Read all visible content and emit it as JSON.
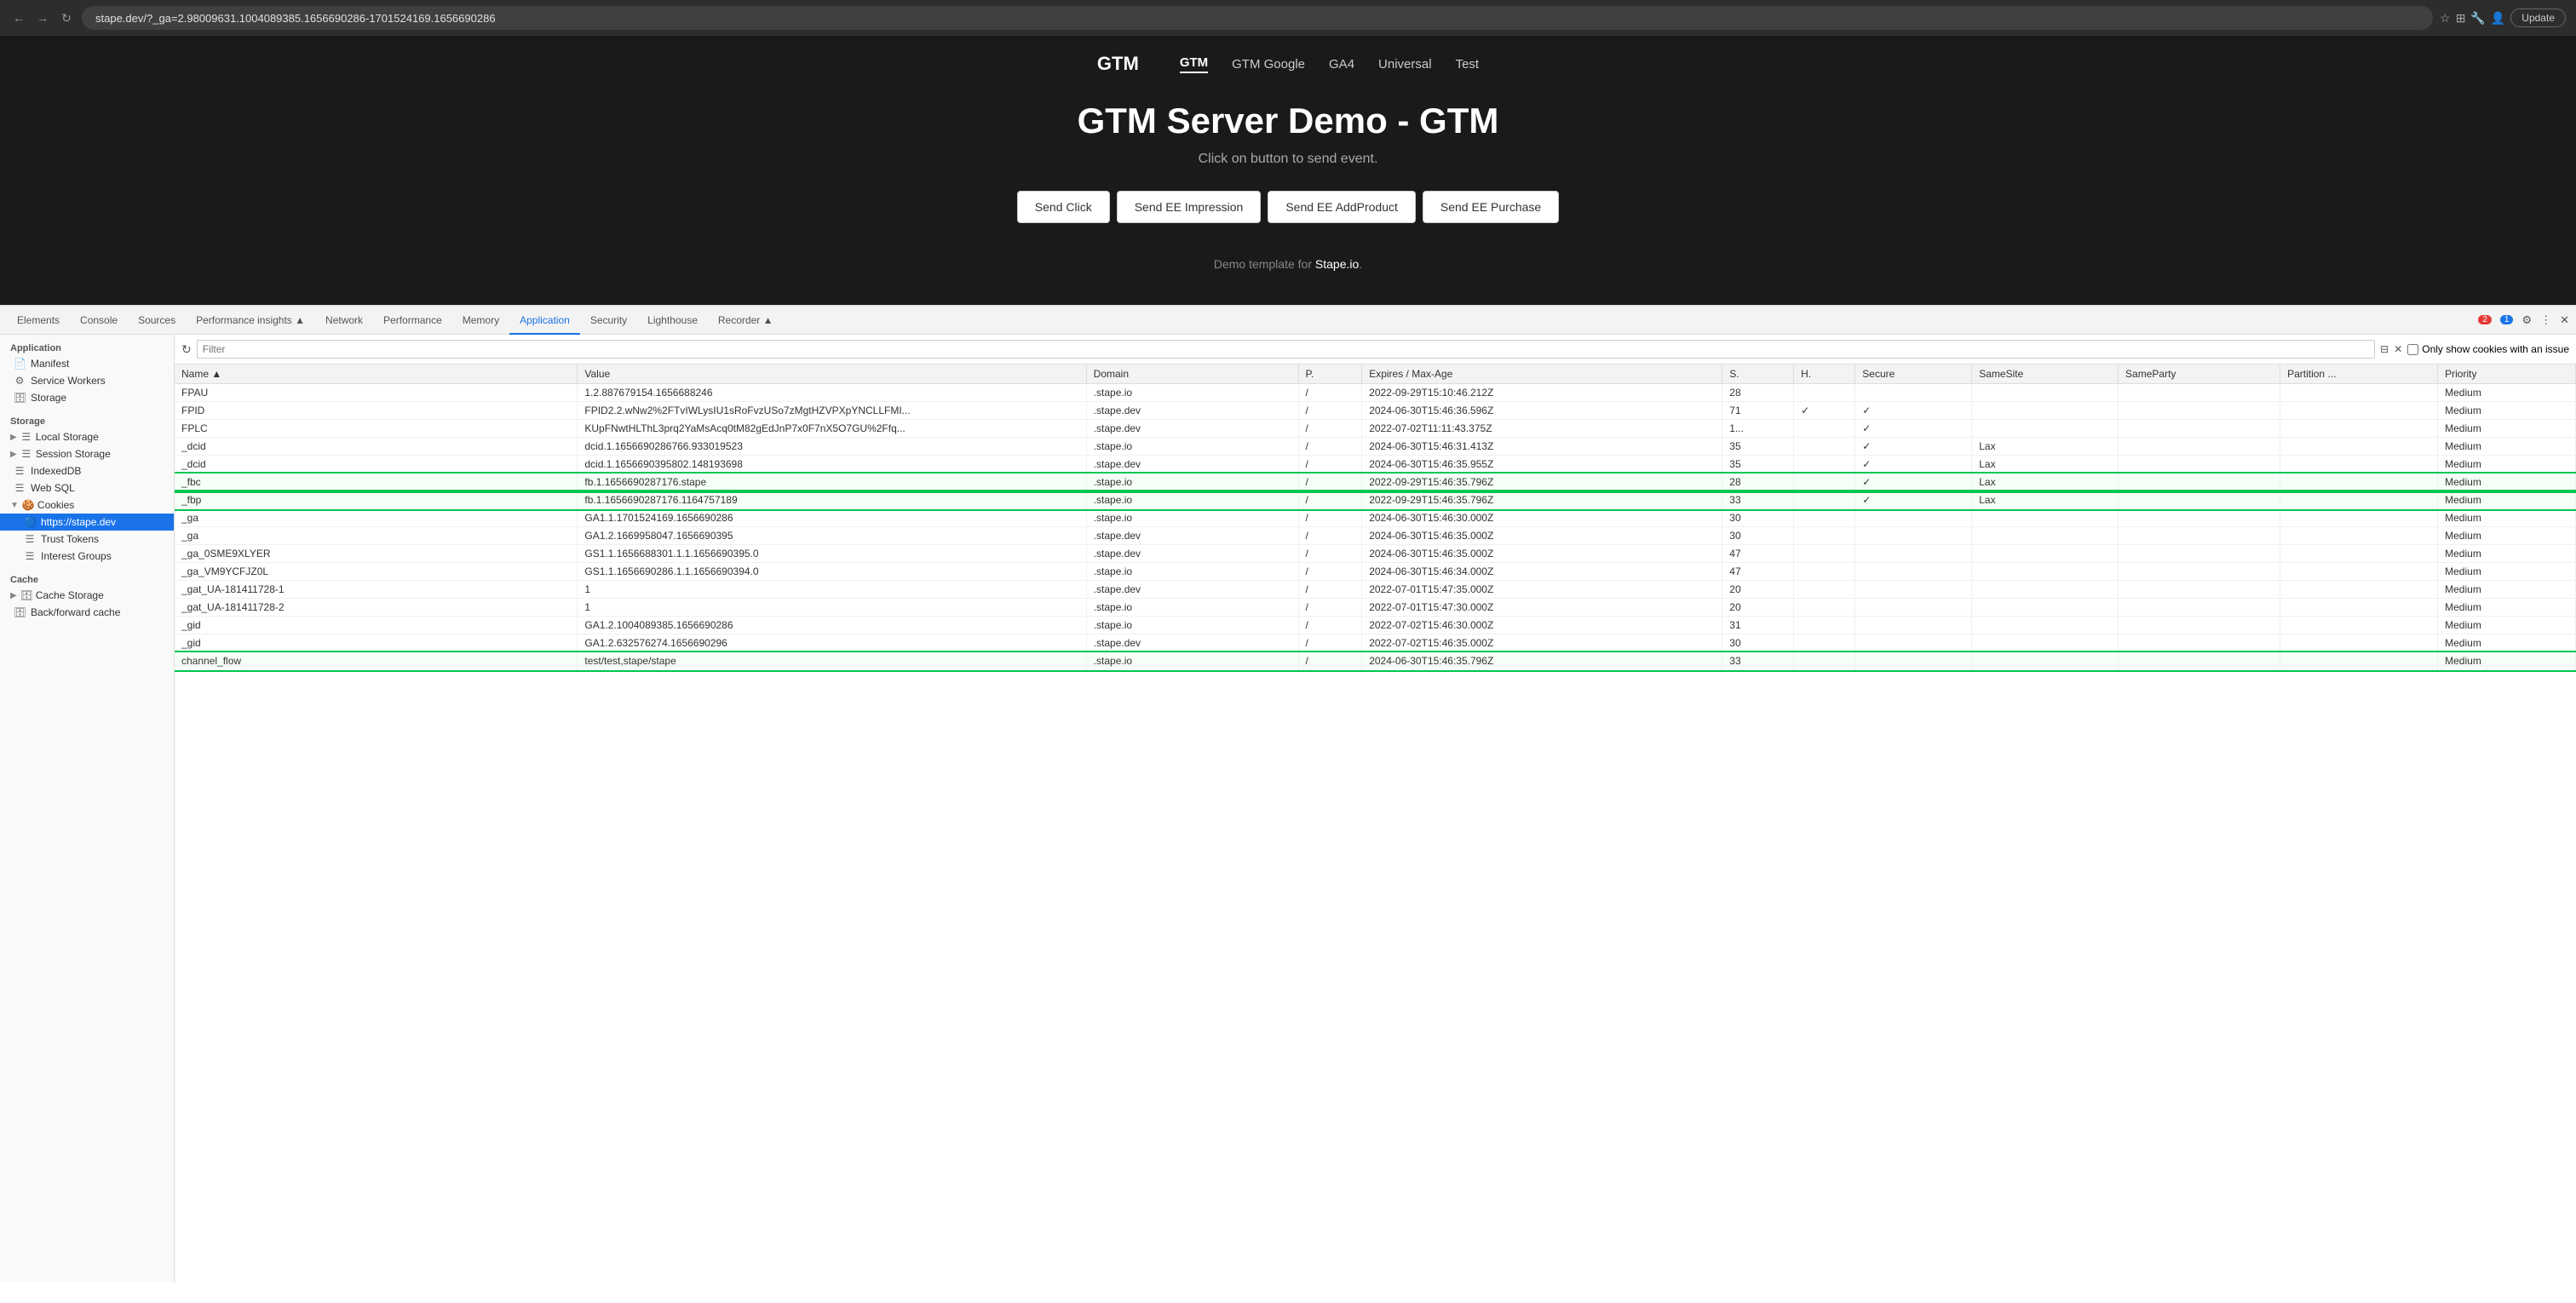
{
  "browser": {
    "url": "stape.dev/?_ga=2.98009631.1004089385.1656690286-1701524169.1656690286",
    "update_label": "Update"
  },
  "site": {
    "logo": "GTM",
    "nav_items": [
      {
        "label": "GTM",
        "active": true
      },
      {
        "label": "GTM Google",
        "active": false
      },
      {
        "label": "GA4",
        "active": false
      },
      {
        "label": "Universal",
        "active": false
      },
      {
        "label": "Test",
        "active": false
      }
    ],
    "title": "GTM Server Demo - GTM",
    "subtitle": "Click on button to send event.",
    "buttons": [
      {
        "label": "Send Click"
      },
      {
        "label": "Send EE Impression"
      },
      {
        "label": "Send EE AddProduct"
      },
      {
        "label": "Send EE Purchase"
      }
    ],
    "footer": "Demo template for Stape.io."
  },
  "devtools": {
    "tabs": [
      {
        "label": "Elements"
      },
      {
        "label": "Console"
      },
      {
        "label": "Sources"
      },
      {
        "label": "Performance insights"
      },
      {
        "label": "Network"
      },
      {
        "label": "Performance"
      },
      {
        "label": "Memory"
      },
      {
        "label": "Application",
        "active": true
      },
      {
        "label": "Security"
      },
      {
        "label": "Lighthouse"
      },
      {
        "label": "Recorder"
      }
    ],
    "badge_red": "2",
    "badge_blue": "1",
    "sidebar": {
      "sections": [
        {
          "title": "Application",
          "items": [
            {
              "label": "Manifest",
              "icon": "📄",
              "type": "item"
            },
            {
              "label": "Service Workers",
              "icon": "⚙",
              "type": "item"
            },
            {
              "label": "Storage",
              "icon": "🗄",
              "type": "item"
            }
          ]
        },
        {
          "title": "Storage",
          "items": [
            {
              "label": "Local Storage",
              "icon": "☰",
              "type": "group",
              "expanded": false
            },
            {
              "label": "Session Storage",
              "icon": "☰",
              "type": "group",
              "expanded": false
            },
            {
              "label": "IndexedDB",
              "icon": "☰",
              "type": "item"
            },
            {
              "label": "Web SQL",
              "icon": "☰",
              "type": "item"
            },
            {
              "label": "Cookies",
              "icon": "🍪",
              "type": "group",
              "expanded": true
            }
          ]
        },
        {
          "title": "Cookies",
          "items": [
            {
              "label": "https://stape.dev",
              "icon": "🔵",
              "type": "item",
              "active": true
            },
            {
              "label": "Trust Tokens",
              "icon": "☰",
              "type": "item"
            },
            {
              "label": "Interest Groups",
              "icon": "☰",
              "type": "item"
            }
          ]
        },
        {
          "title": "Cache",
          "items": [
            {
              "label": "Cache Storage",
              "icon": "🗄",
              "type": "group",
              "expanded": false
            },
            {
              "label": "Back/forward cache",
              "icon": "🗄",
              "type": "item"
            }
          ]
        }
      ]
    },
    "filter": {
      "placeholder": "Filter",
      "show_cookies_with_issue": "Only show cookies with an issue"
    },
    "table": {
      "columns": [
        "Name",
        "Value",
        "Domain",
        "P.",
        "Expires / Max-Age",
        "S.",
        "H.",
        "Secure",
        "SameSite",
        "SameParty",
        "Partition ...",
        "Priority"
      ],
      "rows": [
        {
          "name": "FPAU",
          "value": "1.2.887679154.1656688246",
          "domain": ".stape.io",
          "path": "/",
          "expires": "2022-09-29T15:10:46.212Z",
          "size": "28",
          "h": "",
          "secure": "",
          "samesite": "",
          "sameparty": "",
          "partition": "",
          "priority": "Medium",
          "highlighted": false
        },
        {
          "name": "FPID",
          "value": "FPID2.2.wNw2%2FTvIWLysIU1sRoFvzUSo7zMgtHZVPXpYNCLLFMI...",
          "domain": ".stape.dev",
          "path": "/",
          "expires": "2024-06-30T15:46:36.596Z",
          "size": "71",
          "h": "✓",
          "secure": "✓",
          "samesite": "",
          "sameparty": "",
          "partition": "",
          "priority": "Medium",
          "highlighted": false
        },
        {
          "name": "FPLC",
          "value": "KUpFNwtHLThL3prq2YaMsAcq0tM82gEdJnP7x0F7nX5O7GU%2Ffq...",
          "domain": ".stape.dev",
          "path": "/",
          "expires": "2022-07-02T11:11:43.375Z",
          "size": "1...",
          "h": "",
          "secure": "✓",
          "samesite": "",
          "sameparty": "",
          "partition": "",
          "priority": "Medium",
          "highlighted": false
        },
        {
          "name": "_dcid",
          "value": "dcid.1.1656690286766.933019523",
          "domain": ".stape.io",
          "path": "/",
          "expires": "2024-06-30T15:46:31.413Z",
          "size": "35",
          "h": "",
          "secure": "✓",
          "samesite": "Lax",
          "sameparty": "",
          "partition": "",
          "priority": "Medium",
          "highlighted": false
        },
        {
          "name": "_dcid",
          "value": "dcid.1.1656690395802.148193698",
          "domain": ".stape.dev",
          "path": "/",
          "expires": "2024-06-30T15:46:35.955Z",
          "size": "35",
          "h": "",
          "secure": "✓",
          "samesite": "Lax",
          "sameparty": "",
          "partition": "",
          "priority": "Medium",
          "highlighted": false
        },
        {
          "name": "_fbc",
          "value": "fb.1.1656690287176.stape",
          "domain": ".stape.io",
          "path": "/",
          "expires": "2022-09-29T15:46:35.796Z",
          "size": "28",
          "h": "",
          "secure": "✓",
          "samesite": "Lax",
          "sameparty": "",
          "partition": "",
          "priority": "Medium",
          "highlighted": true
        },
        {
          "name": "_fbp",
          "value": "fb.1.1656690287176.1164757189",
          "domain": ".stape.io",
          "path": "/",
          "expires": "2022-09-29T15:46:35.796Z",
          "size": "33",
          "h": "",
          "secure": "✓",
          "samesite": "Lax",
          "sameparty": "",
          "partition": "",
          "priority": "Medium",
          "highlighted": true
        },
        {
          "name": "_ga",
          "value": "GA1.1.1701524169.1656690286",
          "domain": ".stape.io",
          "path": "/",
          "expires": "2024-06-30T15:46:30.000Z",
          "size": "30",
          "h": "",
          "secure": "",
          "samesite": "",
          "sameparty": "",
          "partition": "",
          "priority": "Medium",
          "highlighted": false
        },
        {
          "name": "_ga",
          "value": "GA1.2.1669958047.1656690395",
          "domain": ".stape.dev",
          "path": "/",
          "expires": "2024-06-30T15:46:35.000Z",
          "size": "30",
          "h": "",
          "secure": "",
          "samesite": "",
          "sameparty": "",
          "partition": "",
          "priority": "Medium",
          "highlighted": false
        },
        {
          "name": "_ga_0SME9XLYER",
          "value": "GS1.1.1656688301.1.1.1656690395.0",
          "domain": ".stape.dev",
          "path": "/",
          "expires": "2024-06-30T15:46:35.000Z",
          "size": "47",
          "h": "",
          "secure": "",
          "samesite": "",
          "sameparty": "",
          "partition": "",
          "priority": "Medium",
          "highlighted": false
        },
        {
          "name": "_ga_VM9YCFJZ0L",
          "value": "GS1.1.1656690286.1.1.1656690394.0",
          "domain": ".stape.io",
          "path": "/",
          "expires": "2024-06-30T15:46:34.000Z",
          "size": "47",
          "h": "",
          "secure": "",
          "samesite": "",
          "sameparty": "",
          "partition": "",
          "priority": "Medium",
          "highlighted": false
        },
        {
          "name": "_gat_UA-181411728-1",
          "value": "1",
          "domain": ".stape.dev",
          "path": "/",
          "expires": "2022-07-01T15:47:35.000Z",
          "size": "20",
          "h": "",
          "secure": "",
          "samesite": "",
          "sameparty": "",
          "partition": "",
          "priority": "Medium",
          "highlighted": false
        },
        {
          "name": "_gat_UA-181411728-2",
          "value": "1",
          "domain": ".stape.io",
          "path": "/",
          "expires": "2022-07-01T15:47:30.000Z",
          "size": "20",
          "h": "",
          "secure": "",
          "samesite": "",
          "sameparty": "",
          "partition": "",
          "priority": "Medium",
          "highlighted": false
        },
        {
          "name": "_gid",
          "value": "GA1.2.1004089385.1656690286",
          "domain": ".stape.io",
          "path": "/",
          "expires": "2022-07-02T15:46:30.000Z",
          "size": "31",
          "h": "",
          "secure": "",
          "samesite": "",
          "sameparty": "",
          "partition": "",
          "priority": "Medium",
          "highlighted": false
        },
        {
          "name": "_gid",
          "value": "GA1.2.632576274.1656690296",
          "domain": ".stape.dev",
          "path": "/",
          "expires": "2022-07-02T15:46:35.000Z",
          "size": "30",
          "h": "",
          "secure": "",
          "samesite": "",
          "sameparty": "",
          "partition": "",
          "priority": "Medium",
          "highlighted": false
        },
        {
          "name": "channel_flow",
          "value": "test/test,stape/stape",
          "domain": ".stape.io",
          "path": "/",
          "expires": "2024-06-30T15:46:35.796Z",
          "size": "33",
          "h": "",
          "secure": "",
          "samesite": "",
          "sameparty": "",
          "partition": "",
          "priority": "Medium",
          "highlighted": true
        }
      ]
    }
  }
}
